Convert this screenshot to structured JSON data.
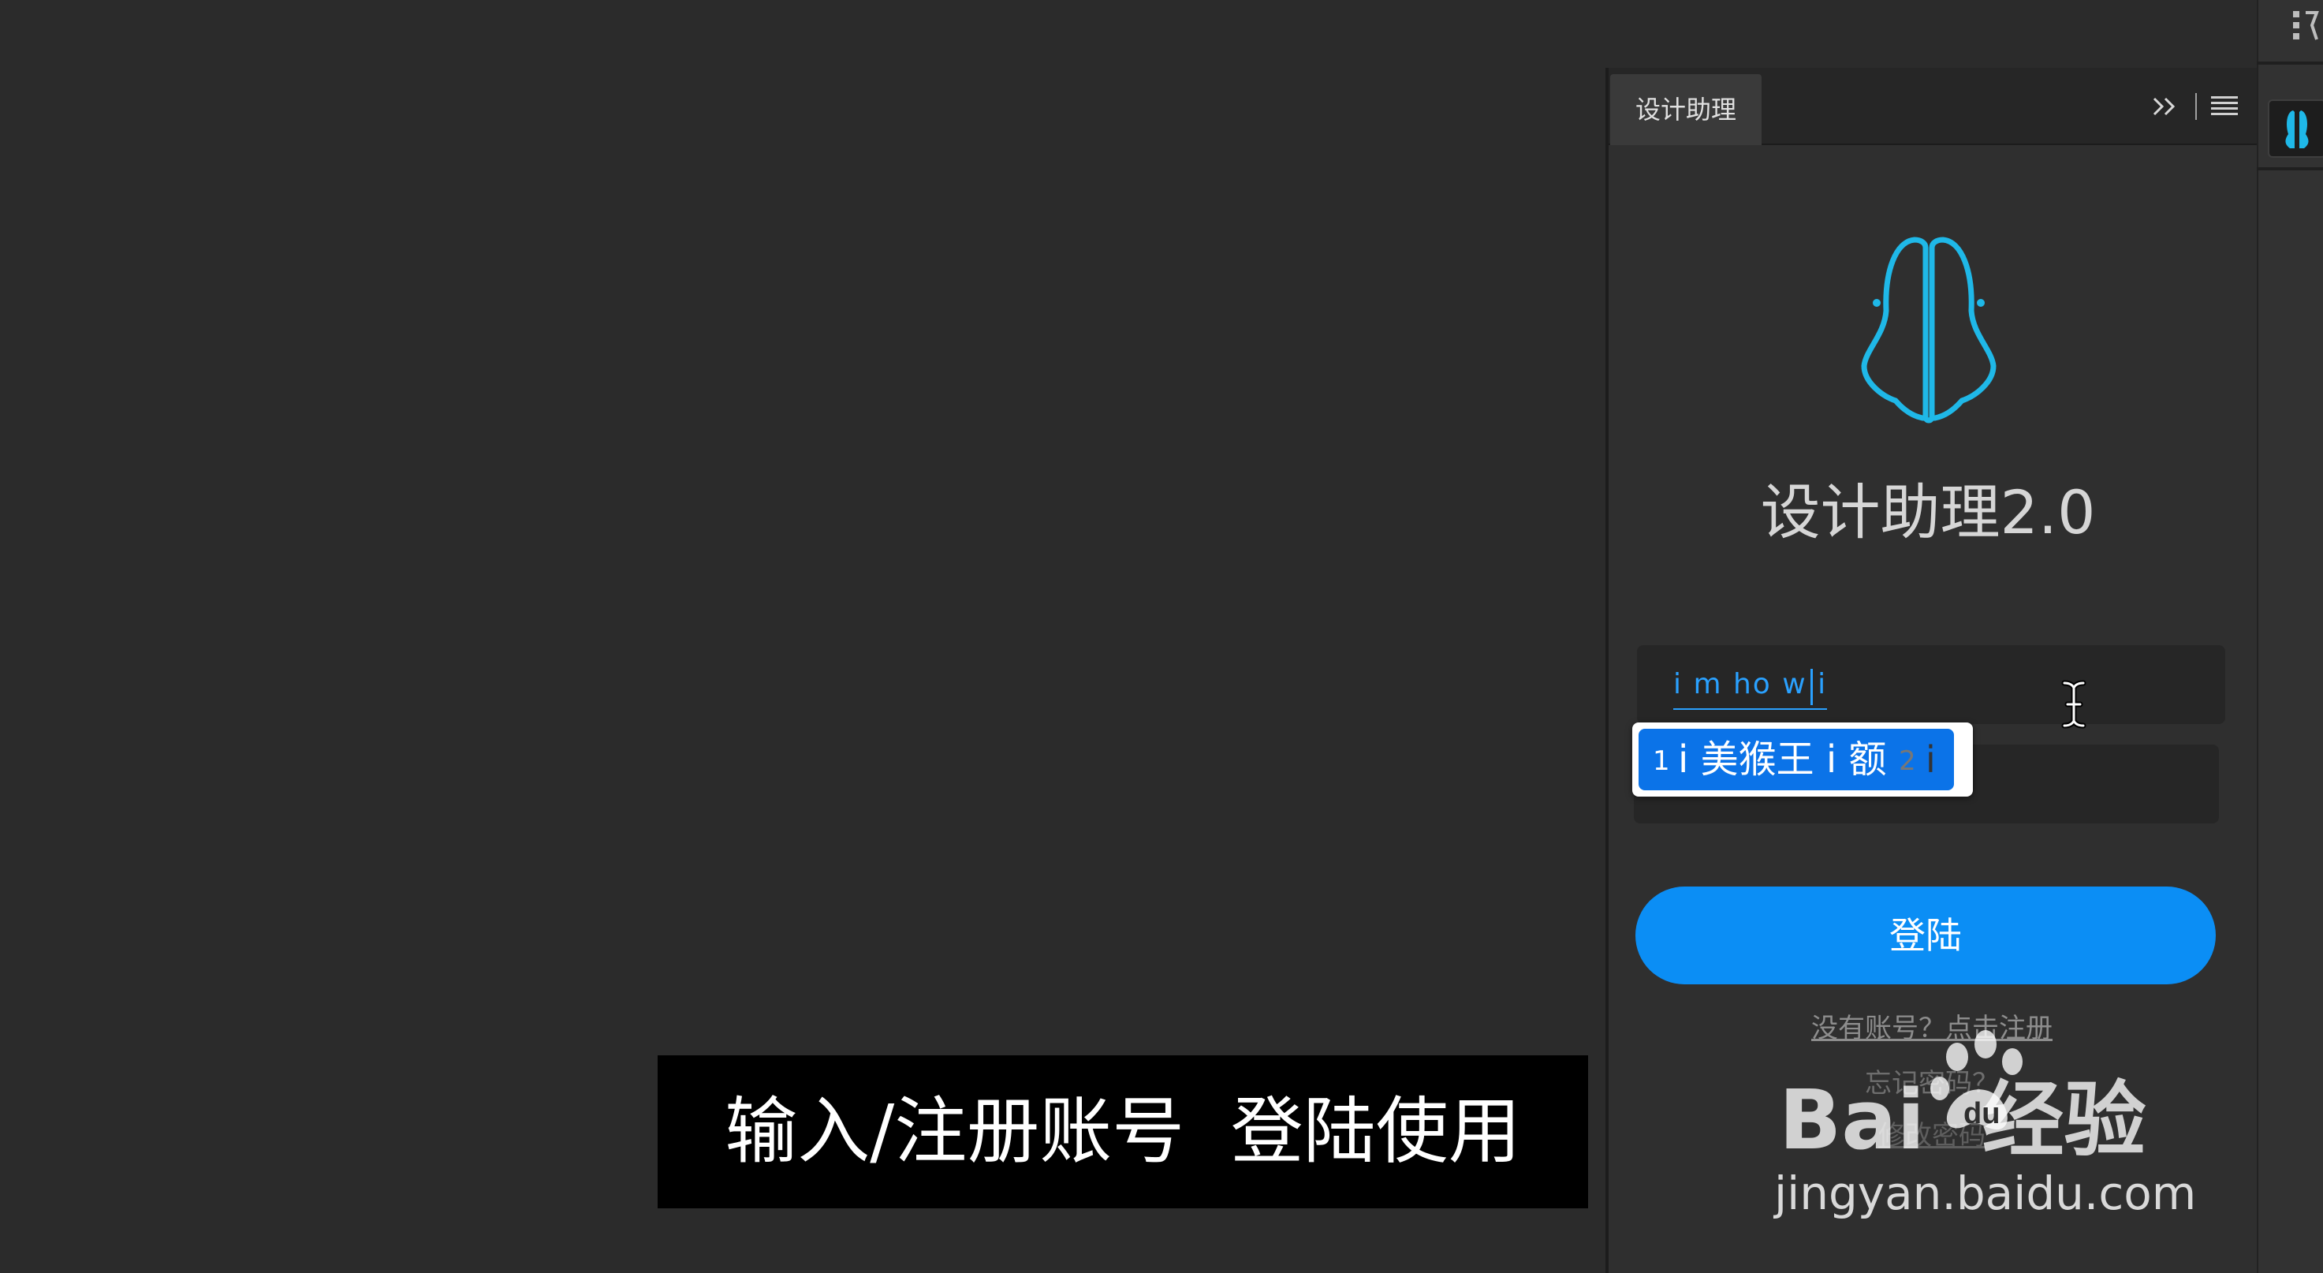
{
  "panel": {
    "tab_label": "设计助理",
    "collapse_icon": "double-chevron-right-icon",
    "menu_icon": "hamburger-menu-icon"
  },
  "app": {
    "title": "设计助理2.0",
    "logo_icon": "app-logo-icon",
    "accent_color": "#1fb8e8"
  },
  "form": {
    "username_value": "i m ho w i",
    "password_value": "",
    "login_label": "登陆",
    "register_link": "没有账号？点击注册",
    "forgot_link": "忘记密码？",
    "extra_link": "修改密码"
  },
  "ime": {
    "candidates": [
      {
        "index": "1",
        "text": "i 美猴王 i 额",
        "selected": true
      },
      {
        "index": "2",
        "text": "i",
        "selected": false
      }
    ],
    "selected_color": "#0b73e8"
  },
  "colors": {
    "button": "#0b8ef5",
    "input_text": "#2aa1ff",
    "background": "#2b2b2b"
  },
  "dock": {
    "top_icon": "panel-arrange-icon",
    "app_icon": "app-logo-icon"
  },
  "caption": {
    "text": "输入/注册账号  登陆使用"
  },
  "watermark": {
    "brand": "Bai  经验",
    "url": "jingyan.baidu.com"
  }
}
